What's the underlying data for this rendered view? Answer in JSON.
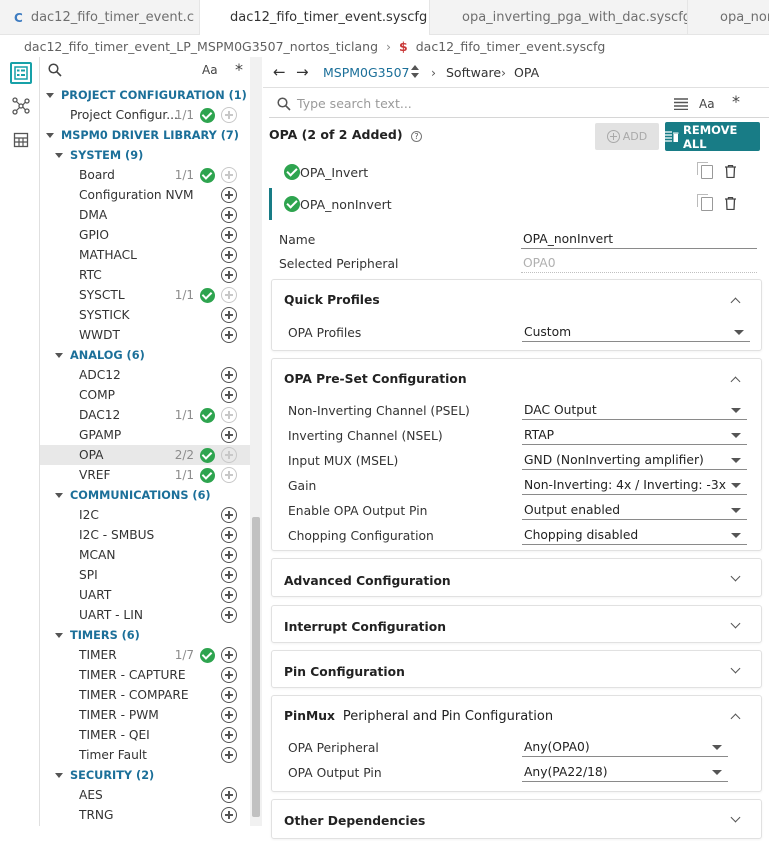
{
  "tabs": [
    {
      "label": "dac12_fifo_timer_event.c",
      "icon": "C"
    },
    {
      "label": "dac12_fifo_timer_event.syscfg",
      "close": "×"
    },
    {
      "label": "opa_inverting_pga_with_dac.syscfg"
    },
    {
      "label": "opa_non"
    }
  ],
  "breadcrumb": {
    "project": "dac12_fifo_timer_event_LP_MSPM0G3507_nortos_ticlang",
    "separator": "›",
    "file_icon": "$",
    "file": "dac12_fifo_timer_event.syscfg"
  },
  "sidebar": {
    "search_right1": "Aa",
    "search_right2": "*",
    "rows": [
      {
        "type": "cat",
        "label": "PROJECT CONFIGURATION (1)"
      },
      {
        "type": "item",
        "label": "Project Configur...",
        "count": "1/1",
        "check": true,
        "plus": "dim"
      },
      {
        "type": "cat",
        "label": "MSPM0 DRIVER LIBRARY (7)"
      },
      {
        "type": "sub",
        "label": "SYSTEM (9)"
      },
      {
        "type": "item",
        "label": "Board",
        "count": "1/1",
        "check": true,
        "plus": "dim"
      },
      {
        "type": "item",
        "label": "Configuration NVM",
        "plus": "on"
      },
      {
        "type": "item",
        "label": "DMA",
        "plus": "on"
      },
      {
        "type": "item",
        "label": "GPIO",
        "plus": "on"
      },
      {
        "type": "item",
        "label": "MATHACL",
        "plus": "on"
      },
      {
        "type": "item",
        "label": "RTC",
        "plus": "on"
      },
      {
        "type": "item",
        "label": "SYSCTL",
        "count": "1/1",
        "check": true,
        "plus": "dim"
      },
      {
        "type": "item",
        "label": "SYSTICK",
        "plus": "on"
      },
      {
        "type": "item",
        "label": "WWDT",
        "plus": "on"
      },
      {
        "type": "sub",
        "label": "ANALOG (6)"
      },
      {
        "type": "item",
        "label": "ADC12",
        "plus": "on"
      },
      {
        "type": "item",
        "label": "COMP",
        "plus": "on"
      },
      {
        "type": "item",
        "label": "DAC12",
        "count": "1/1",
        "check": true,
        "plus": "dim"
      },
      {
        "type": "item",
        "label": "GPAMP",
        "plus": "on"
      },
      {
        "type": "item",
        "label": "OPA",
        "count": "2/2",
        "check": true,
        "plus": "dim",
        "highlight": true
      },
      {
        "type": "item",
        "label": "VREF",
        "count": "1/1",
        "check": true,
        "plus": "dim"
      },
      {
        "type": "sub",
        "label": "COMMUNICATIONS (6)"
      },
      {
        "type": "item",
        "label": "I2C",
        "plus": "on"
      },
      {
        "type": "item",
        "label": "I2C - SMBUS",
        "plus": "on"
      },
      {
        "type": "item",
        "label": "MCAN",
        "plus": "on"
      },
      {
        "type": "item",
        "label": "SPI",
        "plus": "on"
      },
      {
        "type": "item",
        "label": "UART",
        "plus": "on"
      },
      {
        "type": "item",
        "label": "UART - LIN",
        "plus": "on"
      },
      {
        "type": "sub",
        "label": "TIMERS (6)"
      },
      {
        "type": "item",
        "label": "TIMER",
        "count": "1/7",
        "check": true,
        "plus": "on"
      },
      {
        "type": "item",
        "label": "TIMER - CAPTURE",
        "plus": "on"
      },
      {
        "type": "item",
        "label": "TIMER - COMPARE",
        "plus": "on"
      },
      {
        "type": "item",
        "label": "TIMER - PWM",
        "plus": "on"
      },
      {
        "type": "item",
        "label": "TIMER - QEI",
        "plus": "on"
      },
      {
        "type": "item",
        "label": "Timer Fault",
        "plus": "on"
      },
      {
        "type": "sub",
        "label": "SECURITY (2)"
      },
      {
        "type": "item",
        "label": "AES",
        "plus": "on"
      },
      {
        "type": "item",
        "label": "TRNG",
        "plus": "on"
      }
    ]
  },
  "nav": {
    "back": "←",
    "forward": "→",
    "device": "MSPM0G3507",
    "sep": "›",
    "crumb1": "Software",
    "crumb2": "OPA"
  },
  "search": {
    "placeholder": "Type search text...",
    "aa": "Aa",
    "star": "*"
  },
  "opa": {
    "heading": "OPA (2 of 2 Added)",
    "help": "?",
    "add_label": "ADD",
    "remove_label": "REMOVE ALL",
    "instances": [
      "OPA_Invert",
      "OPA_nonInvert"
    ]
  },
  "props": {
    "name_label": "Name",
    "name_value": "OPA_nonInvert",
    "periph_label": "Selected Peripheral",
    "periph_value": "OPA0"
  },
  "sections": {
    "quick_profiles": {
      "title": "Quick Profiles",
      "fields": [
        {
          "label": "OPA Profiles",
          "value": "Custom"
        }
      ]
    },
    "preset": {
      "title": "OPA Pre-Set Configuration",
      "fields": [
        {
          "label": "Non-Inverting Channel (PSEL)",
          "value": "DAC Output"
        },
        {
          "label": "Inverting Channel (NSEL)",
          "value": "RTAP"
        },
        {
          "label": "Input MUX (MSEL)",
          "value": "GND (NonInverting amplifier)"
        },
        {
          "label": "Gain",
          "value": "Non-Inverting: 4x / Inverting: -3x"
        },
        {
          "label": "Enable OPA Output Pin",
          "value": "Output enabled"
        },
        {
          "label": "Chopping Configuration",
          "value": "Chopping disabled"
        }
      ]
    },
    "advanced": {
      "title": "Advanced Configuration"
    },
    "interrupt": {
      "title": "Interrupt Configuration"
    },
    "pin": {
      "title": "Pin Configuration"
    },
    "pinmux": {
      "title": "PinMux",
      "subtitle": "Peripheral and Pin Configuration",
      "fields": [
        {
          "label": "OPA Peripheral",
          "value": "Any(OPA0)"
        },
        {
          "label": "OPA Output Pin",
          "value": "Any(PA22/18)"
        }
      ]
    },
    "other": {
      "title": "Other Dependencies"
    }
  },
  "colors": {
    "accent": "#187c86",
    "link": "#1b6f99",
    "check": "#2ea44f"
  }
}
